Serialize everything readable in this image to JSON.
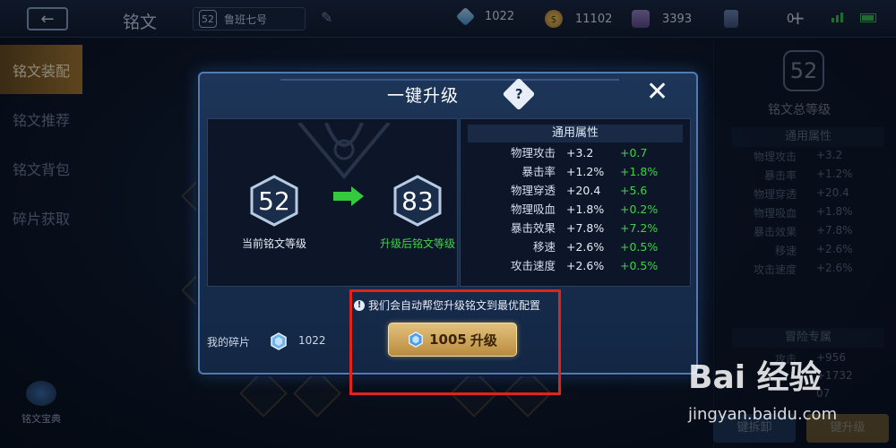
{
  "topbar": {
    "title": "铭文",
    "hero_level": "52",
    "hero_name": "鲁班七号",
    "resources": [
      {
        "icon": "crystal-icon",
        "value": "1022"
      },
      {
        "icon": "coin-icon",
        "value": "11102"
      },
      {
        "icon": "chest-icon",
        "value": "3393"
      },
      {
        "icon": "card-icon",
        "value": "0"
      }
    ]
  },
  "sidebar": {
    "items": [
      {
        "label": "铭文装配",
        "active": true
      },
      {
        "label": "铭文推荐",
        "active": false
      },
      {
        "label": "铭文背包",
        "active": false
      },
      {
        "label": "碎片获取",
        "active": false
      }
    ],
    "codex_label": "铭文宝典"
  },
  "right_panel": {
    "total_level": "52",
    "total_level_label": "铭文总等级",
    "section_label": "通用属性",
    "attrs": [
      {
        "name": "物理攻击",
        "value": "+3.2"
      },
      {
        "name": "暴击率",
        "value": "+1.2%"
      },
      {
        "name": "物理穿透",
        "value": "+20.4"
      },
      {
        "name": "物理吸血",
        "value": "+1.8%"
      },
      {
        "name": "暴击效果",
        "value": "+7.8%"
      },
      {
        "name": "移速",
        "value": "+2.6%"
      },
      {
        "name": "攻击速度",
        "value": "+2.6%"
      }
    ],
    "adventure_label": "冒险专属",
    "adventure_attrs": [
      {
        "name": "攻击",
        "value": "+956"
      },
      {
        "name": "",
        "value": "+1732"
      },
      {
        "name": "",
        "value": "07"
      }
    ],
    "btn_unload": "键拆卸",
    "btn_upgrade": "键升级"
  },
  "modal": {
    "title": "一键升级",
    "current_level": "52",
    "current_label": "当前铭文等级",
    "next_level": "83",
    "next_label": "升级后铭文等级",
    "attr_header": "通用属性",
    "attrs": [
      {
        "name": "物理攻击",
        "value": "+3.2",
        "delta": "+0.7"
      },
      {
        "name": "暴击率",
        "value": "+1.2%",
        "delta": "+1.8%"
      },
      {
        "name": "物理穿透",
        "value": "+20.4",
        "delta": "+5.6"
      },
      {
        "name": "物理吸血",
        "value": "+1.8%",
        "delta": "+0.2%"
      },
      {
        "name": "暴击效果",
        "value": "+7.8%",
        "delta": "+7.2%"
      },
      {
        "name": "移速",
        "value": "+2.6%",
        "delta": "+0.5%"
      },
      {
        "name": "攻击速度",
        "value": "+2.6%",
        "delta": "+0.5%"
      }
    ],
    "notice": "我们会自动帮您升级铭文到最优配置",
    "fragments_label": "我的碎片",
    "fragments_count": "1022",
    "upgrade_cost": "1005",
    "upgrade_label": "升级"
  },
  "watermark": {
    "logo": "Bai 经验",
    "url": "jingyan.baidu.com"
  },
  "colors": {
    "accent_green": "#3fd14a",
    "highlight_red": "#e0241b",
    "button_gold": "#c99d4c"
  }
}
